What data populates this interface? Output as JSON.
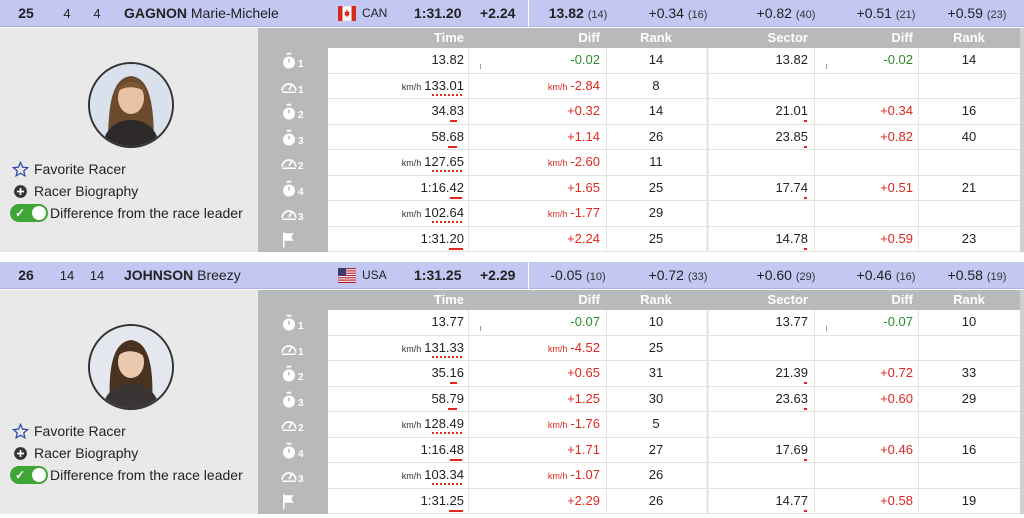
{
  "columns": {
    "time": "Time",
    "diff": "Diff",
    "rank": "Rank",
    "sector": "Sector",
    "sector_diff": "Diff",
    "sector_rank": "Rank"
  },
  "actions": {
    "favorite": "Favorite Racer",
    "biography": "Racer Biography",
    "difference": "Difference from the race leader"
  },
  "speed_unit": "km/h",
  "colors": {
    "header_bg": "#c3c8f3",
    "positive": "#2e8b2e",
    "negative": "#e0281f",
    "icon_col": "#b8b9bb",
    "toggle_on": "#3fa535"
  },
  "racers": [
    {
      "rank": "25",
      "bib": "4",
      "order": "4",
      "last_name": "GAGNON",
      "first_name": "Marie-Michele",
      "flag_icon": "flag-canada-icon",
      "nation": "CAN",
      "time": "1:31.20",
      "diff": "+2.24",
      "splits": [
        {
          "value": "13.82",
          "rank": "(14)"
        },
        {
          "value": "+0.34",
          "rank": "(16)"
        },
        {
          "value": "+0.82",
          "rank": "(40)"
        },
        {
          "value": "+0.51",
          "rank": "(21)"
        },
        {
          "value": "+0.59",
          "rank": "(23)"
        }
      ],
      "rows": [
        {
          "icon": "stopwatch-icon",
          "sub": "1",
          "time": "13.82",
          "diff": "-0.02",
          "rank": "14",
          "sector": "13.82",
          "sdiff": "-0.02",
          "srank": "14"
        },
        {
          "icon": "speedometer-icon",
          "sub": "1",
          "speed": "133.01",
          "diff": "-2.84",
          "rank": "8"
        },
        {
          "icon": "stopwatch-icon",
          "sub": "2",
          "time": "34.83",
          "diff": "+0.32",
          "rank": "14",
          "sector": "21.01",
          "sdiff": "+0.34",
          "srank": "16"
        },
        {
          "icon": "stopwatch-icon",
          "sub": "3",
          "time": "58.68",
          "diff": "+1.14",
          "rank": "26",
          "sector": "23.85",
          "sdiff": "+0.82",
          "srank": "40"
        },
        {
          "icon": "speedometer-icon",
          "sub": "2",
          "speed": "127.65",
          "diff": "-2.60",
          "rank": "11"
        },
        {
          "icon": "stopwatch-icon",
          "sub": "4",
          "time": "1:16.42",
          "diff": "+1.65",
          "rank": "25",
          "sector": "17.74",
          "sdiff": "+0.51",
          "srank": "21"
        },
        {
          "icon": "speedometer-icon",
          "sub": "3",
          "speed": "102.64",
          "diff": "-1.77",
          "rank": "29"
        },
        {
          "icon": "finish-flag-icon",
          "sub": "",
          "time": "1:31.20",
          "diff": "+2.24",
          "rank": "25",
          "sector": "14.78",
          "sdiff": "+0.59",
          "srank": "23"
        }
      ]
    },
    {
      "rank": "26",
      "bib": "14",
      "order": "14",
      "last_name": "JOHNSON",
      "first_name": "Breezy",
      "flag_icon": "flag-usa-icon",
      "nation": "USA",
      "time": "1:31.25",
      "diff": "+2.29",
      "splits": [
        {
          "value": "-0.05",
          "rank": "(10)"
        },
        {
          "value": "+0.72",
          "rank": "(33)"
        },
        {
          "value": "+0.60",
          "rank": "(29)"
        },
        {
          "value": "+0.46",
          "rank": "(16)"
        },
        {
          "value": "+0.58",
          "rank": "(19)"
        }
      ],
      "rows": [
        {
          "icon": "stopwatch-icon",
          "sub": "1",
          "time": "13.77",
          "diff": "-0.07",
          "rank": "10",
          "sector": "13.77",
          "sdiff": "-0.07",
          "srank": "10"
        },
        {
          "icon": "speedometer-icon",
          "sub": "1",
          "speed": "131.33",
          "diff": "-4.52",
          "rank": "25"
        },
        {
          "icon": "stopwatch-icon",
          "sub": "2",
          "time": "35.16",
          "diff": "+0.65",
          "rank": "31",
          "sector": "21.39",
          "sdiff": "+0.72",
          "srank": "33"
        },
        {
          "icon": "stopwatch-icon",
          "sub": "3",
          "time": "58.79",
          "diff": "+1.25",
          "rank": "30",
          "sector": "23.63",
          "sdiff": "+0.60",
          "srank": "29"
        },
        {
          "icon": "speedometer-icon",
          "sub": "2",
          "speed": "128.49",
          "diff": "-1.76",
          "rank": "5"
        },
        {
          "icon": "stopwatch-icon",
          "sub": "4",
          "time": "1:16.48",
          "diff": "+1.71",
          "rank": "27",
          "sector": "17.69",
          "sdiff": "+0.46",
          "srank": "16"
        },
        {
          "icon": "speedometer-icon",
          "sub": "3",
          "speed": "103.34",
          "diff": "-1.07",
          "rank": "26"
        },
        {
          "icon": "finish-flag-icon",
          "sub": "",
          "time": "1:31.25",
          "diff": "+2.29",
          "rank": "26",
          "sector": "14.77",
          "sdiff": "+0.58",
          "srank": "19"
        }
      ]
    }
  ]
}
